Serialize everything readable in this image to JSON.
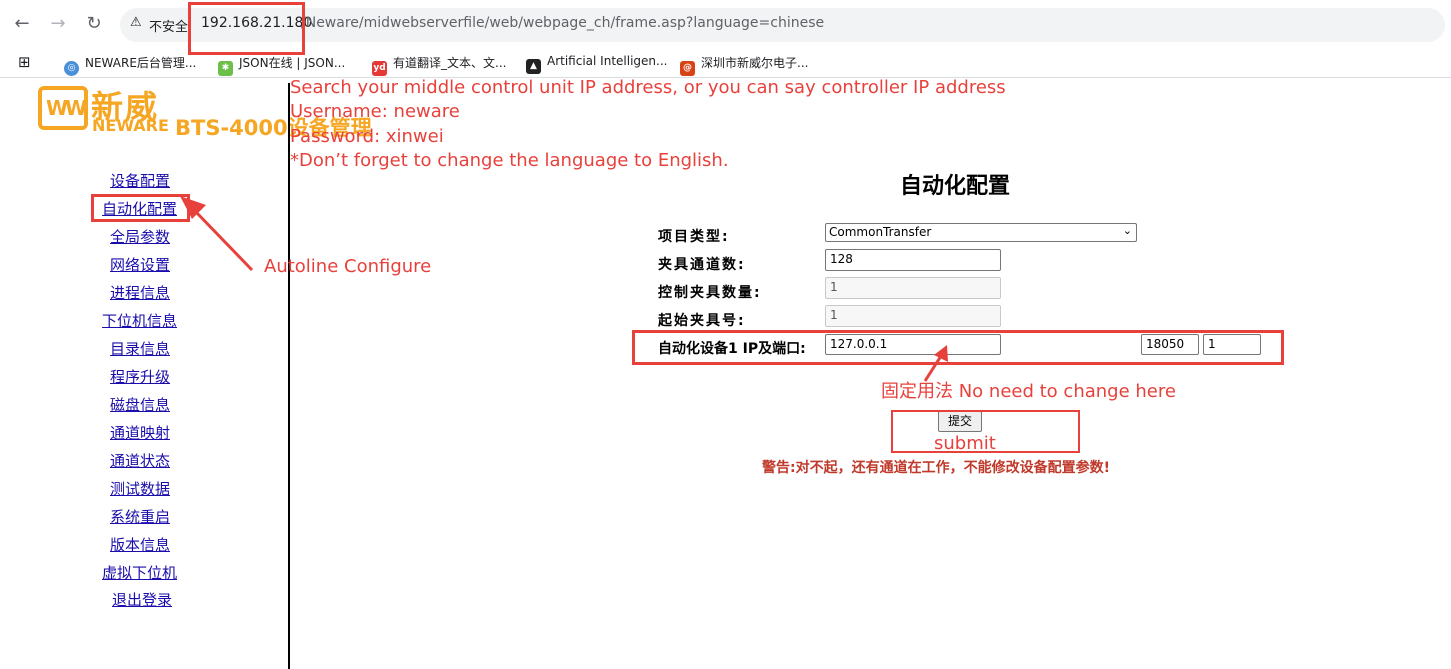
{
  "browser": {
    "security_label": "不安全",
    "url_host": "192.168.21.180",
    "url_path": "/Neware/midwebserverfile/web/webpage_ch/frame.asp?language=chinese",
    "bookmarks": [
      {
        "label": "NEWARE后台管理...",
        "icon": "globe-icon"
      },
      {
        "label": "JSON在线 | JSON...",
        "icon": "json-icon"
      },
      {
        "label": "有道翻译_文本、文...",
        "icon": "youdao-icon"
      },
      {
        "label": "Artificial Intelligen...",
        "icon": "ai-icon"
      },
      {
        "label": "深圳市新威尔电子...",
        "icon": "neware-icon"
      }
    ]
  },
  "logo": {
    "cn": "新威",
    "en": "NEWARE",
    "mark": "WW",
    "app_title": "BTS-4000设备管理"
  },
  "sidebar": {
    "items": [
      {
        "label": "设备配置"
      },
      {
        "label": "自动化配置"
      },
      {
        "label": "全局参数"
      },
      {
        "label": "网络设置"
      },
      {
        "label": "进程信息"
      },
      {
        "label": "下位机信息"
      },
      {
        "label": "目录信息"
      },
      {
        "label": "程序升级"
      },
      {
        "label": "磁盘信息"
      },
      {
        "label": "通道映射"
      },
      {
        "label": "通道状态"
      },
      {
        "label": "测试数据"
      },
      {
        "label": "系统重启"
      },
      {
        "label": "版本信息"
      },
      {
        "label": "虚拟下位机"
      },
      {
        "label": "退出登录"
      }
    ]
  },
  "annotations": {
    "line1": "Search your middle control unit IP address, or you can say controller IP address",
    "line2": "Username: neware",
    "line3": "Password: xinwei",
    "line4": "*Don’t forget to change the language to English.",
    "autoline": "Autoline Configure",
    "fixed": "固定用法  No need to change here",
    "submit": "submit"
  },
  "form": {
    "title": "自动化配置",
    "project_type_label": "项目类型:",
    "project_type_value": "CommonTransfer",
    "fixture_channels_label": "夹具通道数:",
    "fixture_channels_value": "128",
    "control_fixture_count_label": "控制夹具数量:",
    "control_fixture_count_value": "1",
    "start_fixture_label": "起始夹具号:",
    "start_fixture_value": "1",
    "device_ip_label": "自动化设备1 IP及端口:",
    "device_ip_value": "127.0.0.1",
    "device_port_value": "18050",
    "device_extra_value": "1",
    "submit_label": "提交",
    "warning": "警告:对不起，还有通道在工作，不能修改设备配置参数!"
  },
  "colors": {
    "annotation_red": "#e8413c",
    "logo_orange": "#f5a623",
    "link_blue": "#1a0dab",
    "warning_red": "#c0392b"
  }
}
